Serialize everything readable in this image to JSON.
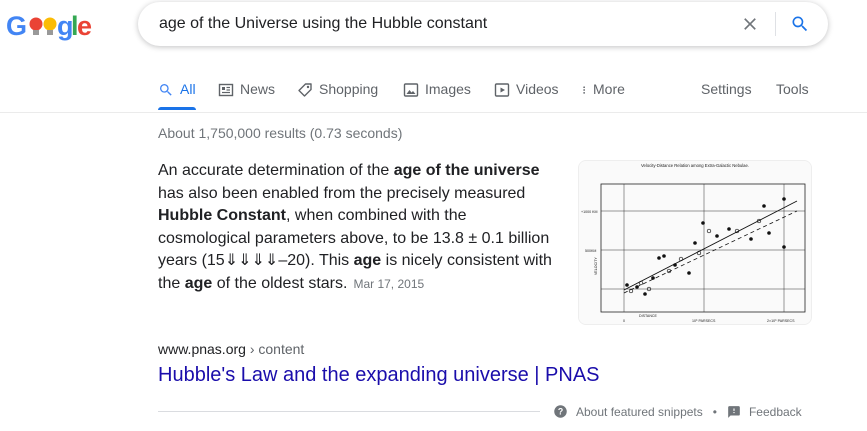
{
  "logo": {
    "text": "Google"
  },
  "search": {
    "query": "age of the Universe using the Hubble constant"
  },
  "tabs": [
    {
      "label": "All",
      "icon": "search-icon",
      "active": true
    },
    {
      "label": "News",
      "icon": "news-icon"
    },
    {
      "label": "Shopping",
      "icon": "tag-icon"
    },
    {
      "label": "Images",
      "icon": "image-icon"
    },
    {
      "label": "Videos",
      "icon": "video-icon"
    },
    {
      "label": "More",
      "icon": "more-icon"
    }
  ],
  "tools": {
    "settings": "Settings",
    "tools": "Tools"
  },
  "stats": "About 1,750,000 results (0.73 seconds)",
  "snippet": {
    "t1": "An accurate determination of the ",
    "b1": "age of the universe",
    "t2": " has also been enabled from the precisely measured ",
    "b2": "Hubble Constant",
    "t3": ", when combined with the cosmological parameters above, to be 13.8 ± 0.1 billion years (15⇓⇓⇓⇓–20). This ",
    "b3": "age",
    "t4": " is nicely consistent with the ",
    "b4": "age",
    "t5": " of the oldest stars.",
    "date": "Mar 17, 2015"
  },
  "figure": {
    "title": "Velocity-Distance Relation among Extra-Galactic Nebulae.",
    "ylabel": "VELOCITY",
    "xlabel": "DISTANCE",
    "ytick_top": "+1000 KM",
    "ytick_mid": "500KM",
    "xtick_0": "0",
    "xtick_mid": "10⁶ PARSECS",
    "xtick_end": "2×10⁶ PARSECS"
  },
  "result": {
    "domain": "www.pnas.org",
    "crumb": " › content",
    "title": "Hubble's Law and the expanding universe | PNAS"
  },
  "footer": {
    "about": "About featured snippets",
    "feedback": "Feedback",
    "dot": "•"
  },
  "colors": {
    "link": "#1a0dab",
    "accent": "#1a73e8",
    "secondary": "#70757a"
  }
}
